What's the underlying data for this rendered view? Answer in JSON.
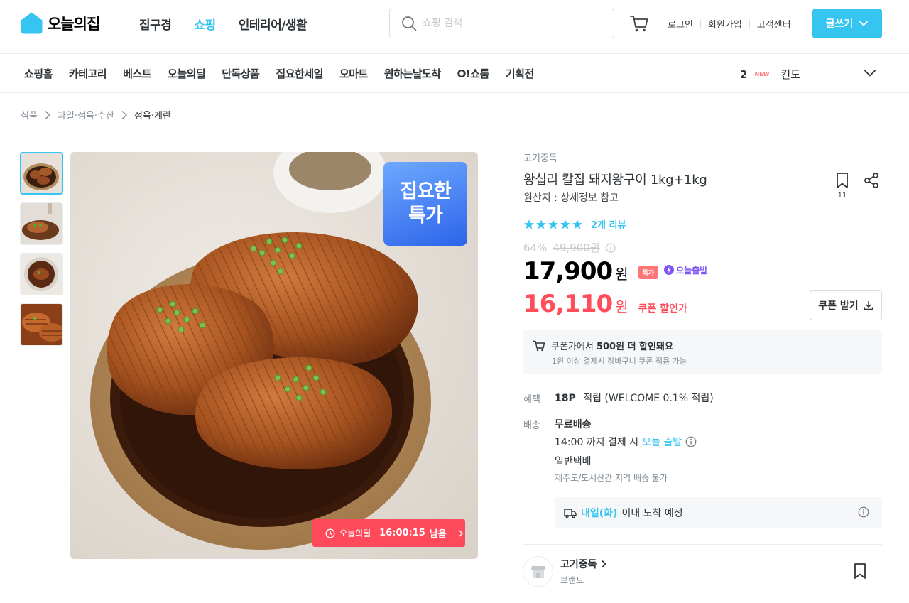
{
  "header": {
    "logo_text": "오늘의집",
    "nav": [
      "집구경",
      "쇼핑",
      "인테리어/생활"
    ],
    "active_nav": "쇼핑",
    "search_placeholder": "쇼핑 검색",
    "util": [
      "로그인",
      "회원가입",
      "고객센터"
    ],
    "write_button": "글쓰기",
    "accent_color": "#35c5f0"
  },
  "subnav": {
    "items": [
      "쇼핑홈",
      "카테고리",
      "베스트",
      "오늘의딜",
      "단독상품",
      "집요한세일",
      "오마트",
      "원하는날도착",
      "O!쇼룸",
      "기획전"
    ],
    "rank": {
      "num": "2",
      "badge": "NEW",
      "keyword": "킨도"
    }
  },
  "breadcrumb": [
    "식품",
    "과일·정육·수산",
    "정육·계란"
  ],
  "gallery": {
    "badge_line1": "집요한",
    "badge_line2": "특가",
    "timer_label": "오늘의딜",
    "timer_time": "16:00:15",
    "timer_suffix": "남음"
  },
  "product": {
    "brand": "고기중독",
    "title": "왕십리 칼집 돼지왕구이 1kg+1kg",
    "origin": "원산지 : 상세정보 참고",
    "bookmark_count": "11",
    "stars": 5,
    "review_text": "2개 리뷰",
    "discount": "64%",
    "original_price": "49,900원",
    "price": "17,900",
    "price_unit": "원",
    "special_tag": "특가",
    "today_ship_tag": "오늘출발",
    "coupon_price": "16,110",
    "coupon_unit": "원",
    "coupon_label": "쿠폰 할인가",
    "coupon_button": "쿠폰 받기",
    "sale_color": "#ff4d5c"
  },
  "coupon_box": {
    "prefix": "쿠폰가에서",
    "strong": "500원 더 할인돼요",
    "sub": "1원 이상 결제시 장바구니 쿠폰 적용 가능"
  },
  "benefit": {
    "label": "혜택",
    "points": "18P",
    "text": "적립 (WELCOME 0.1% 적립)"
  },
  "shipping": {
    "label": "배송",
    "fee": "무료배송",
    "cutoff": "14:00 까지 결제 시",
    "today": "오늘 출발",
    "type": "일반택배",
    "note": "제주도/도서산간 지역 배송 불가",
    "arrive_day": "내일(화)",
    "arrive_text": "이내 도착 예정"
  },
  "store": {
    "name": "고기중독",
    "sub": "브랜드"
  }
}
